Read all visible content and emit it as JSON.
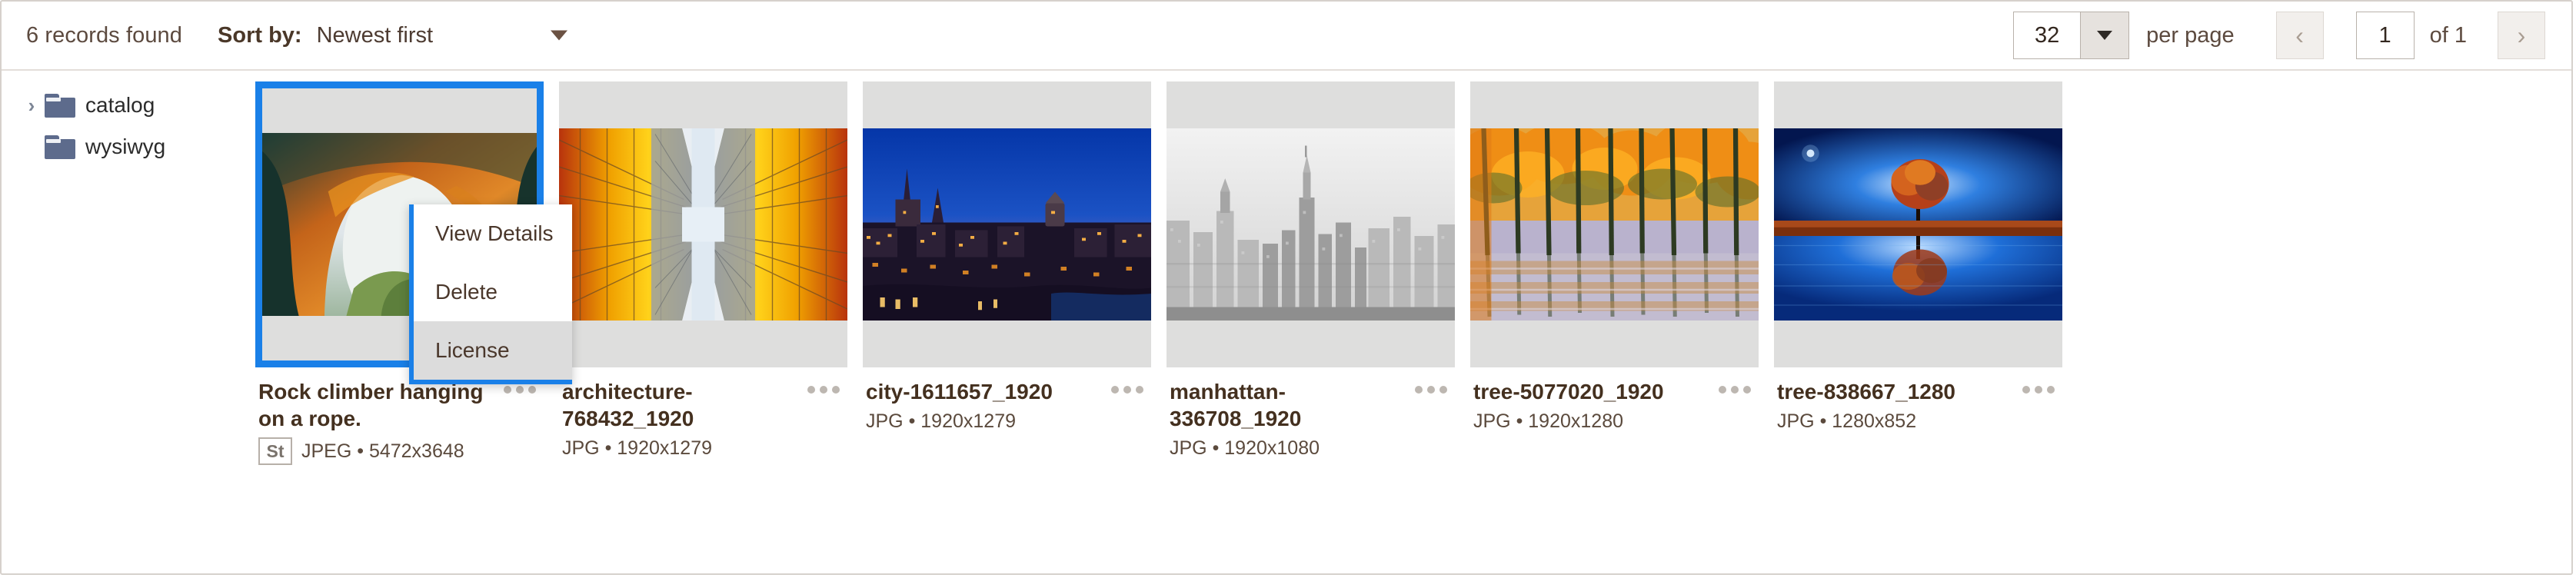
{
  "toolbar": {
    "records_found": "6 records found",
    "sort_label": "Sort by:",
    "sort_value": "Newest first",
    "sort_caret": "caret-down-icon",
    "per_page_value": "32",
    "per_page_label": "per page",
    "prev_icon": "‹",
    "next_icon": "›",
    "page_value": "1",
    "page_of": "of 1"
  },
  "sidebar": {
    "items": [
      {
        "label": "catalog",
        "expandable": true,
        "chevron": "›",
        "icon": "folder-icon"
      },
      {
        "label": "wysiwyg",
        "expandable": false,
        "chevron": "",
        "icon": "folder-icon"
      }
    ]
  },
  "context_menu": {
    "items": [
      {
        "label": "View Details",
        "highlighted": false
      },
      {
        "label": "Delete",
        "highlighted": false
      },
      {
        "label": "License",
        "highlighted": true
      }
    ]
  },
  "grid": {
    "kebab_icon": "more-options-icon",
    "items": [
      {
        "title": "Rock climber hanging on a rope.",
        "badge": "St",
        "meta": "JPEG • 5472x3648",
        "selected": true,
        "thumb": "rock-climber-cave-arch"
      },
      {
        "title": "architecture-768432_1920",
        "badge": "",
        "meta": "JPG • 1920x1279",
        "selected": false,
        "thumb": "architecture-glass-towers"
      },
      {
        "title": "city-1611657_1920",
        "badge": "",
        "meta": "JPG • 1920x1279",
        "selected": false,
        "thumb": "city-blue-hour-skyline"
      },
      {
        "title": "manhattan-336708_1920",
        "badge": "",
        "meta": "JPG • 1920x1080",
        "selected": false,
        "thumb": "manhattan-black-white"
      },
      {
        "title": "tree-5077020_1920",
        "badge": "",
        "meta": "JPG • 1920x1280",
        "selected": false,
        "thumb": "autumn-trees-water"
      },
      {
        "title": "tree-838667_1280",
        "badge": "",
        "meta": "JPG • 1280x852",
        "selected": false,
        "thumb": "lone-tree-blue-night"
      }
    ]
  },
  "colors": {
    "selection_blue": "#1a80e8",
    "text_brown": "#4a372b",
    "folder_slate": "#5d6b8c",
    "thumb_backdrop": "#dededd"
  }
}
